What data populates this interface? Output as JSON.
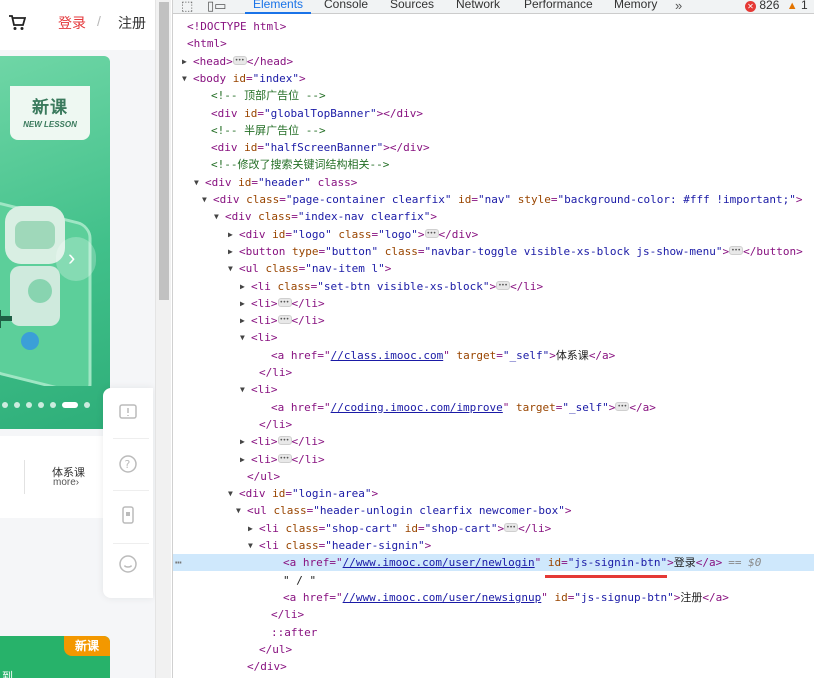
{
  "site": {
    "header": {
      "login": "登录",
      "separator": "/",
      "signup": "注册"
    },
    "banner": {
      "badge_title": "新课",
      "badge_subtitle": "NEW LESSON"
    },
    "course_card": {
      "title": "体系课",
      "more": "more›"
    },
    "newcourse_tag": "新课",
    "newcourse_text": "到",
    "carousel_dots": 7,
    "carousel_active_dot": 6
  },
  "devtools": {
    "tabs": [
      "Elements",
      "Console",
      "Sources",
      "Network",
      "Performance",
      "Memory"
    ],
    "active_tab": "Elements",
    "more_tabs_icon": "»",
    "error_count": "826",
    "warning_count": "1",
    "selected_suffix": "== $0",
    "lines": [
      {
        "t": "<!DOCTYPE html>"
      },
      {
        "t": "<html>"
      },
      {
        "open": "<head>",
        "close": "</head>"
      },
      {
        "t": "<body id=\"index\">"
      },
      {
        "c": "<!-- 顶部广告位 -->"
      },
      {
        "t": "<div id=\"globalTopBanner\"></div>"
      },
      {
        "c": "<!-- 半屏广告位 -->"
      },
      {
        "t": "<div id=\"halfScreenBanner\"></div>"
      },
      {
        "c": "<!--修改了搜索关键词结构相关-->"
      },
      {
        "t": "<div id=\"header\" class>"
      },
      {
        "t": "<div class=\"page-container clearfix\" id=\"nav\" style=\"background-color: #fff !important;\">"
      },
      {
        "t": "<div class=\"index-nav clearfix\">"
      },
      {
        "open": "<div id=\"logo\" class=\"logo\">",
        "close": "</div>"
      },
      {
        "open": "<button type=\"button\" class=\"navbar-toggle visible-xs-block js-show-menu\">",
        "close": "</button>"
      },
      {
        "t": "<ul class=\"nav-item l\">"
      },
      {
        "open": "<li class=\"set-btn visible-xs-block\">",
        "close": "</li>"
      },
      {
        "open": "<li>",
        "close": "</li>"
      },
      {
        "open": "<li>",
        "close": "</li>"
      },
      {
        "t": "<li>"
      },
      {
        "link_open": "<a href=\"",
        "link": "//class.imooc.com",
        "link_close": "\" target=\"_self\">",
        "text": "体系课",
        "end": "</a>"
      },
      {
        "t": "</li>"
      },
      {
        "t": "<li>"
      },
      {
        "link_open": "<a href=\"",
        "link": "//coding.imooc.com/improve",
        "link_close": "\" target=\"_self\">",
        "dots": true,
        "end": "</a>"
      },
      {
        "t": "</li>"
      },
      {
        "open": "<li>",
        "close": "</li>"
      },
      {
        "open": "<li>",
        "close": "</li>"
      },
      {
        "t": "</ul>"
      },
      {
        "t": "<div id=\"login-area\">"
      },
      {
        "t": "<ul class=\"header-unlogin clearfix newcomer-box\">"
      },
      {
        "open": "<li class=\"shop-cart\" id=\"shop-cart\">",
        "close": "</li>"
      },
      {
        "t": "<li class=\"header-signin\">"
      },
      {
        "link_open": "<a href=\"",
        "link": "//www.imooc.com/user/newlogin",
        "link_close": "\" id=\"js-signin-btn\">",
        "text": "登录",
        "end": "</a>"
      },
      {
        "t": "\" / \""
      },
      {
        "link_open": "<a href=\"",
        "link": "//www.imooc.com/user/newsignup",
        "link_close": "\" id=\"js-signup-btn\">",
        "text": "注册",
        "end": "</a>"
      },
      {
        "t": "</li>"
      },
      {
        "t": "::after"
      },
      {
        "t": "</ul>"
      },
      {
        "t": "</div>"
      }
    ]
  }
}
